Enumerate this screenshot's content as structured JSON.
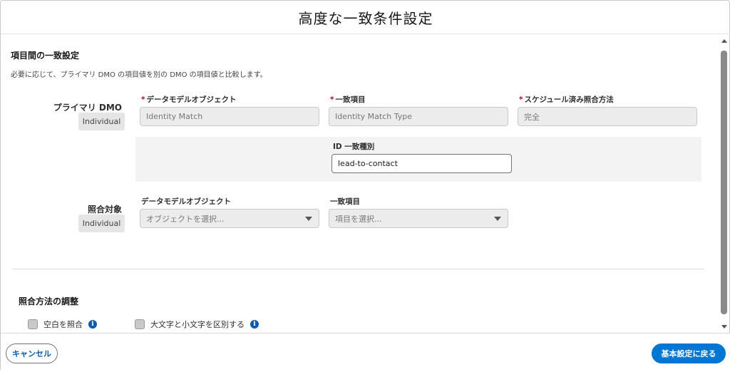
{
  "modal": {
    "title": "高度な一致条件設定"
  },
  "section1": {
    "title": "項目間の一致設定",
    "description": "必要に応じて、プライマリ DMO の項目値を別の DMO の項目値と比較します。"
  },
  "primary": {
    "label": "プライマリ DMO",
    "badge": "Individual",
    "fields": [
      {
        "label": "データモデルオブジェクト",
        "required": "*",
        "value": "Identity Match"
      },
      {
        "label": "一致項目",
        "required": "*",
        "value": "Identity Match Type"
      },
      {
        "label": "スケジュール済み照合方法",
        "required": "*",
        "value": "完全"
      }
    ],
    "id_type": {
      "label": "ID 一致種別",
      "value": "lead-to-contact"
    }
  },
  "target": {
    "label": "照合対象",
    "badge": "Individual",
    "fields": [
      {
        "label": "データモデルオブジェクト",
        "placeholder": "オブジェクトを選択..."
      },
      {
        "label": "一致項目",
        "placeholder": "項目を選択..."
      }
    ]
  },
  "section2": {
    "title": "照合方法の調整",
    "options": [
      {
        "label": "空白を照合",
        "checked": false,
        "info": "i"
      },
      {
        "label": "大文字と小文字を区別する",
        "checked": false,
        "info": "i"
      }
    ]
  },
  "footer": {
    "cancel_label": "キャンセル",
    "back_label": "基本設定に戻る"
  }
}
